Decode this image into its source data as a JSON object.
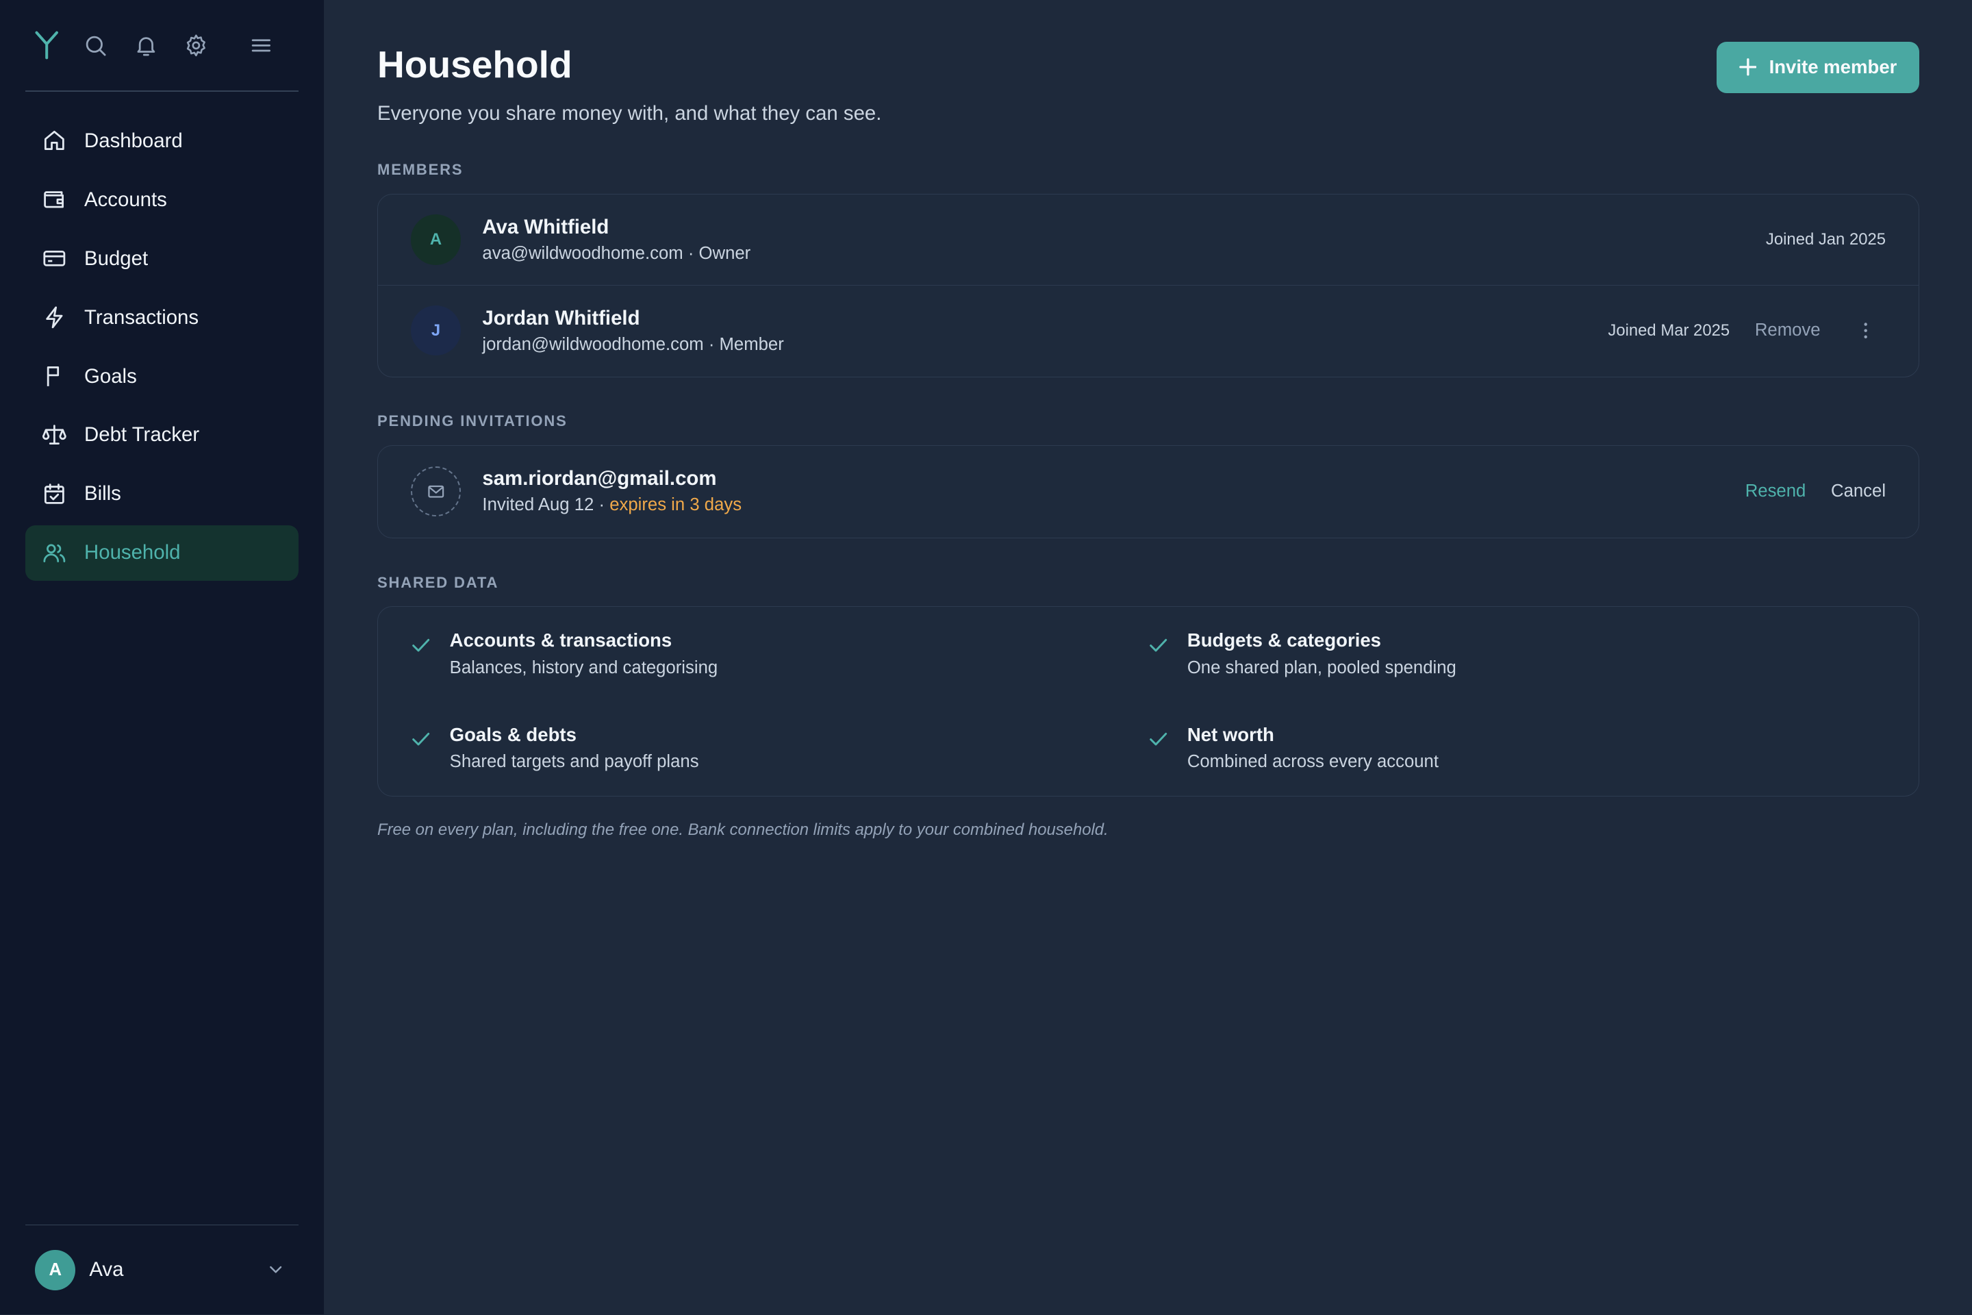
{
  "sidebar": {
    "items": [
      {
        "label": "Dashboard",
        "icon": "home-icon"
      },
      {
        "label": "Accounts",
        "icon": "wallet-icon"
      },
      {
        "label": "Budget",
        "icon": "credit-card-icon"
      },
      {
        "label": "Transactions",
        "icon": "lightning-icon"
      },
      {
        "label": "Goals",
        "icon": "flag-icon"
      },
      {
        "label": "Debt Tracker",
        "icon": "scale-icon"
      },
      {
        "label": "Bills",
        "icon": "calendar-check-icon"
      },
      {
        "label": "Household",
        "icon": "users-icon",
        "active": true
      }
    ],
    "user": {
      "initial": "A",
      "name": "Ava"
    }
  },
  "header": {
    "title": "Household",
    "subtitle": "Everyone you share money with, and what they can see.",
    "invite_label": "Invite member"
  },
  "members": {
    "label": "MEMBERS",
    "rows": [
      {
        "initial": "A",
        "name": "Ava Whitfield",
        "meta": "ava@wildwoodhome.com · Owner",
        "joined": "Joined Jan 2025"
      },
      {
        "initial": "J",
        "name": "Jordan Whitfield",
        "meta": "jordan@wildwoodhome.com · Member",
        "joined": "Joined Mar 2025",
        "remove_label": "Remove"
      }
    ]
  },
  "pending": {
    "label": "PENDING INVITATIONS",
    "email": "sam.riordan@gmail.com",
    "invited": "Invited Aug 12 · ",
    "expires": "expires in 3 days",
    "resend_label": "Resend",
    "cancel_label": "Cancel"
  },
  "shared": {
    "label": "SHARED DATA",
    "items": [
      {
        "title": "Accounts & transactions",
        "desc": "Balances, history and categorising"
      },
      {
        "title": "Budgets & categories",
        "desc": "One shared plan, pooled spending"
      },
      {
        "title": "Goals & debts",
        "desc": "Shared targets and payoff plans"
      },
      {
        "title": "Net worth",
        "desc": "Combined across every account"
      }
    ]
  },
  "footnote": "Free on every plan, including the free one. Bank connection limits apply to your combined household.",
  "colors": {
    "accent": "#4aa8a2",
    "warning": "#f0a94a",
    "sidebar_bg": "#0f172a",
    "main_bg": "#1e293b"
  }
}
